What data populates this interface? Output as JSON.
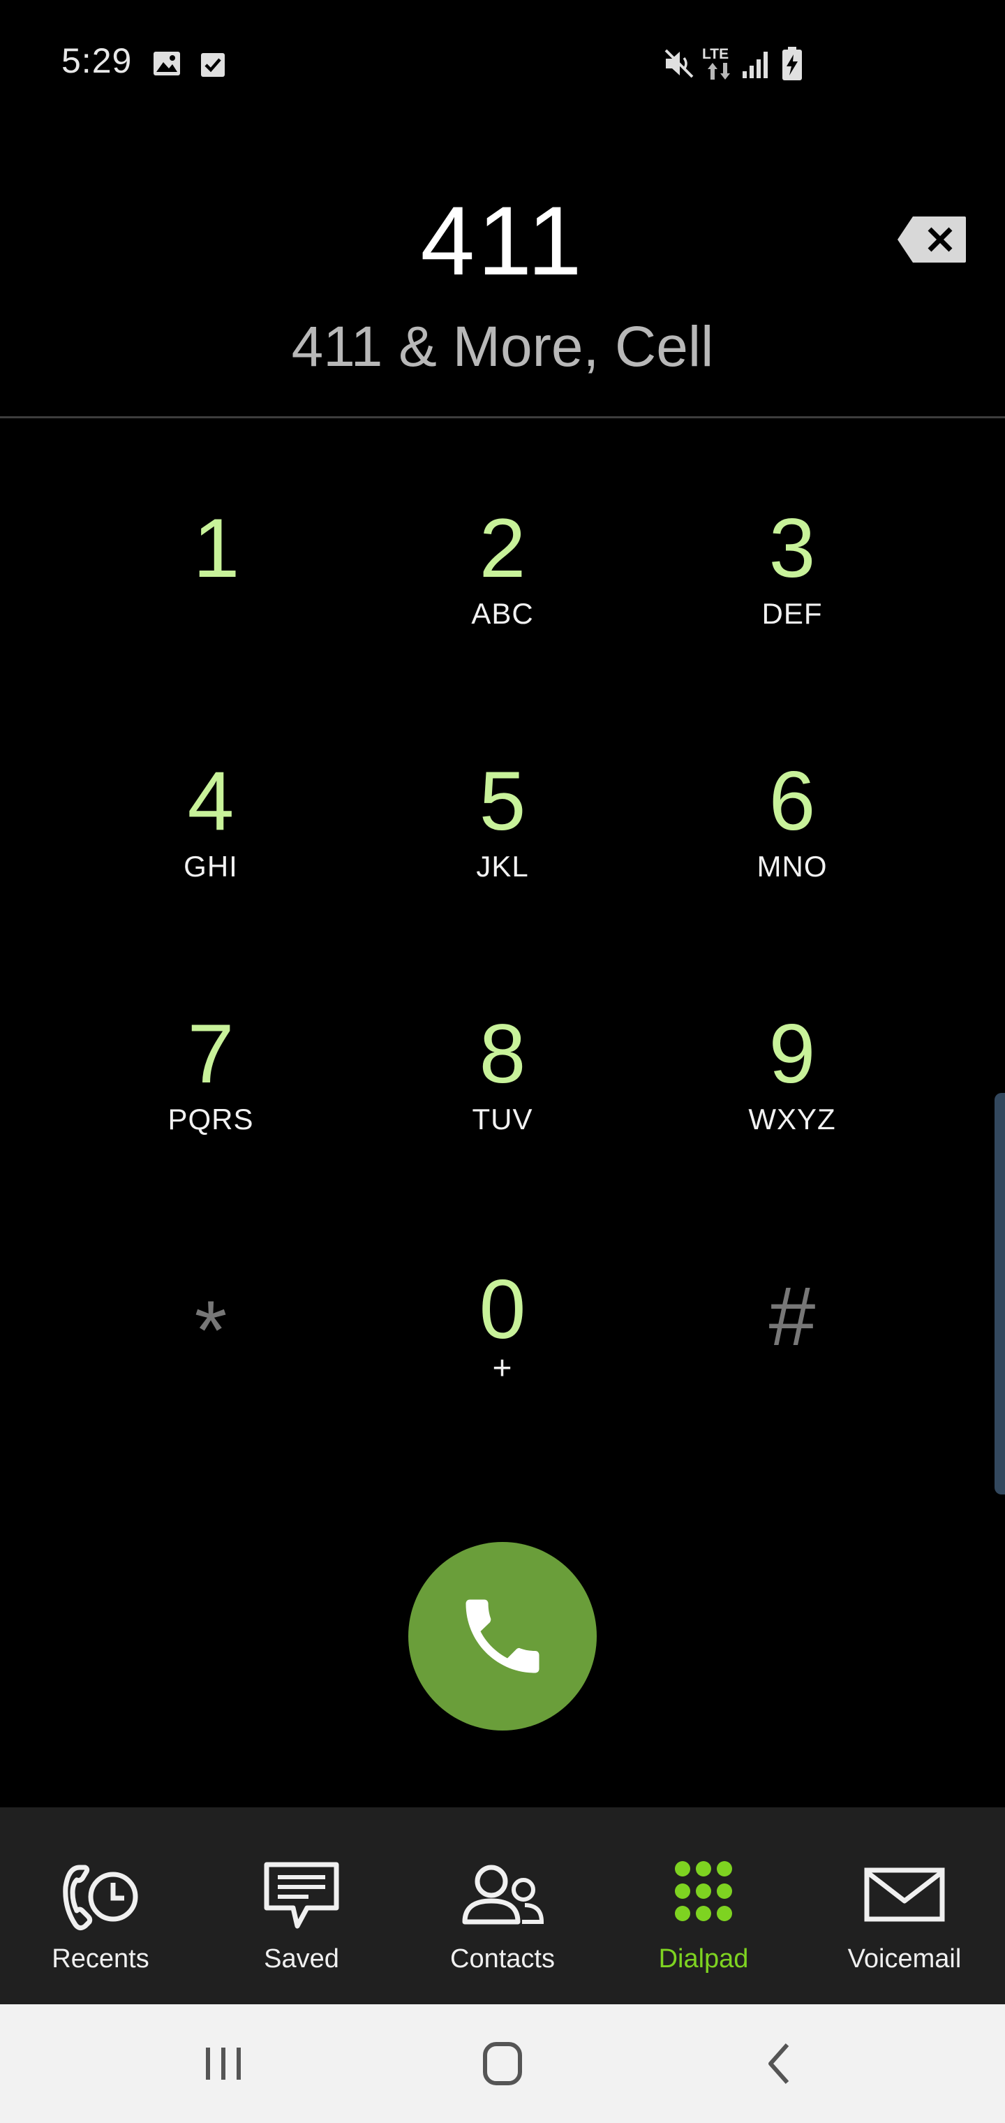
{
  "status_bar": {
    "time": "5:29",
    "left_icons": [
      "image-icon",
      "checkbox-icon"
    ],
    "right_icons": [
      "mute-icon",
      "lte-icon",
      "signal-icon",
      "battery-charging-icon"
    ],
    "lte_label": "LTE"
  },
  "dialer": {
    "number": "411",
    "match": "411 & More, Cell"
  },
  "keypad": [
    {
      "digit": "1",
      "letters": ""
    },
    {
      "digit": "2",
      "letters": "ABC"
    },
    {
      "digit": "3",
      "letters": "DEF"
    },
    {
      "digit": "4",
      "letters": "GHI"
    },
    {
      "digit": "5",
      "letters": "JKL"
    },
    {
      "digit": "6",
      "letters": "MNO"
    },
    {
      "digit": "7",
      "letters": "PQRS"
    },
    {
      "digit": "8",
      "letters": "TUV"
    },
    {
      "digit": "9",
      "letters": "WXYZ"
    },
    {
      "digit": "*",
      "letters": ""
    },
    {
      "digit": "0",
      "letters": "+"
    },
    {
      "digit": "#",
      "letters": ""
    }
  ],
  "bottom_nav": [
    {
      "label": "Recents",
      "icon": "recents-clock-phone-icon",
      "active": false
    },
    {
      "label": "Saved",
      "icon": "chat-bubble-icon",
      "active": false
    },
    {
      "label": "Contacts",
      "icon": "contacts-people-icon",
      "active": false
    },
    {
      "label": "Dialpad",
      "icon": "dialpad-grid-icon",
      "active": true
    },
    {
      "label": "Voicemail",
      "icon": "envelope-icon",
      "active": false
    }
  ],
  "colors": {
    "digit": "#c8f29a",
    "call_button": "#6a9e3a",
    "active_nav": "#7ed321",
    "nav_background": "#202020"
  }
}
